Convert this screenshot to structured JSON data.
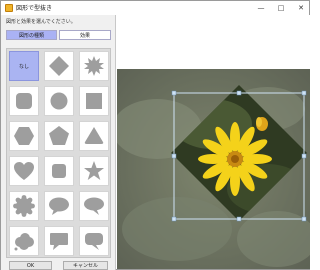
{
  "window": {
    "title": "図形で型抜き"
  },
  "controls": {
    "minimize_glyph": "—",
    "maximize_glyph": "□",
    "close_glyph": "✕"
  },
  "panel": {
    "instruction": "図形と効果を選んでください。",
    "tabs": [
      {
        "label": "図形の種類",
        "active": true
      },
      {
        "label": "効果",
        "active": false
      }
    ],
    "shapes": [
      {
        "name": "none",
        "label": "なし",
        "selected": true
      },
      {
        "name": "diamond"
      },
      {
        "name": "starburst"
      },
      {
        "name": "rounded-rect"
      },
      {
        "name": "circle"
      },
      {
        "name": "square"
      },
      {
        "name": "hexagon"
      },
      {
        "name": "pentagon"
      },
      {
        "name": "rounded-triangle"
      },
      {
        "name": "heart"
      },
      {
        "name": "rounded-square"
      },
      {
        "name": "star"
      },
      {
        "name": "scalloped-circle"
      },
      {
        "name": "ellipse-speech"
      },
      {
        "name": "oval-speech"
      },
      {
        "name": "cloud"
      },
      {
        "name": "rect-speech"
      },
      {
        "name": "rounded-speech"
      }
    ],
    "ok_label": "OK",
    "cancel_label": "キャンセル"
  },
  "colors": {
    "accent": "#aab2f4",
    "shape_gray": "#9e9e9e",
    "handle": "#cfe3f5"
  }
}
